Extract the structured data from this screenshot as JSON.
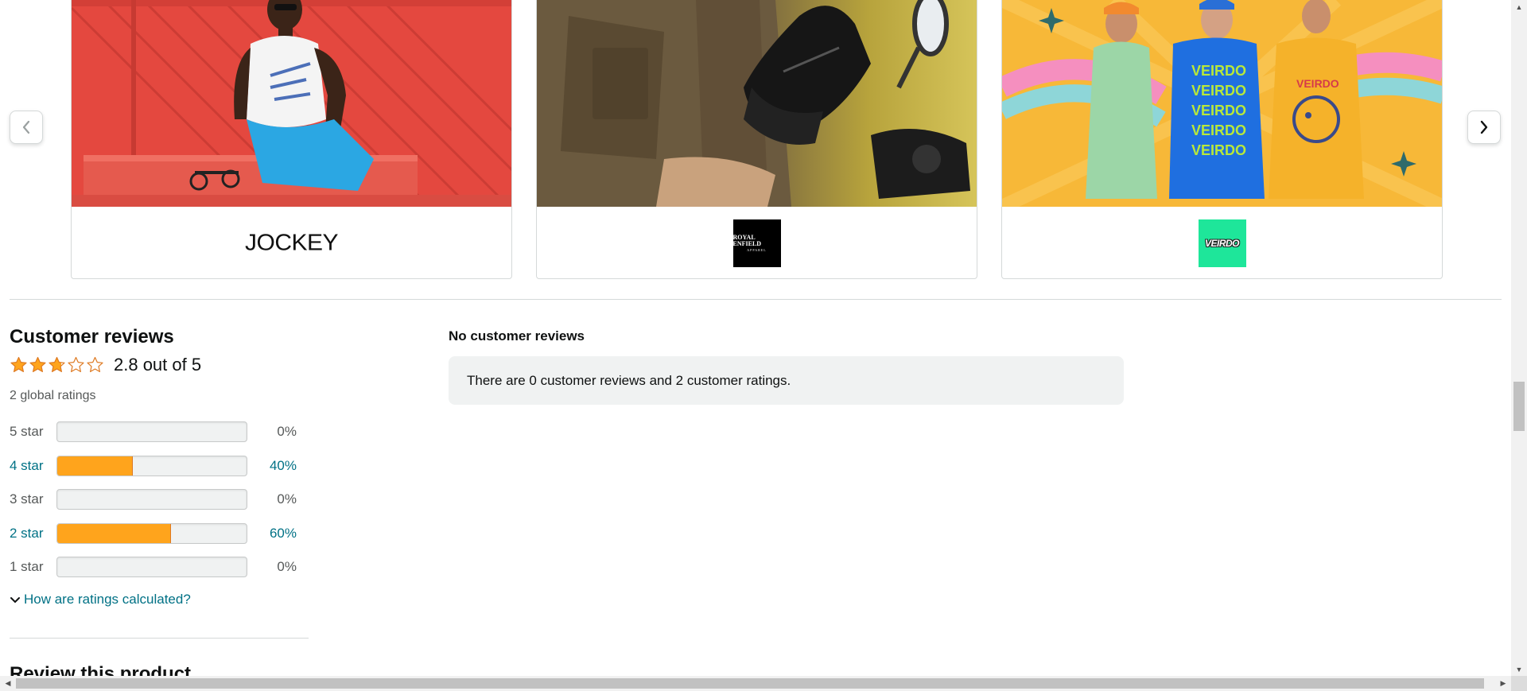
{
  "carousel": {
    "prev_icon": "chevron-left-icon",
    "next_icon": "chevron-right-icon",
    "cards": [
      {
        "brand": "JOCKEY",
        "hero_desc_icon": "model-photo-red-wall"
      },
      {
        "brand_line1": "ROYAL ENFIELD",
        "brand_line2": "APPAREL",
        "hero_desc_icon": "rider-gloves-photo"
      },
      {
        "brand": "VEIRDO",
        "hero_desc_icon": "three-models-tshirts-photo"
      }
    ]
  },
  "reviews": {
    "title": "Customer reviews",
    "rating": 2.8,
    "rating_text": "2.8 out of 5",
    "global_ratings": "2 global ratings",
    "histogram": [
      {
        "label": "5 star",
        "percent_text": "0%",
        "percent": 0,
        "linked": false
      },
      {
        "label": "4 star",
        "percent_text": "40%",
        "percent": 40,
        "linked": true
      },
      {
        "label": "3 star",
        "percent_text": "0%",
        "percent": 0,
        "linked": false
      },
      {
        "label": "2 star",
        "percent_text": "60%",
        "percent": 60,
        "linked": true
      },
      {
        "label": "1 star",
        "percent_text": "0%",
        "percent": 0,
        "linked": false
      }
    ],
    "calc_link": "How are ratings calculated?",
    "review_product_heading": "Review this product"
  },
  "no_reviews": {
    "title": "No customer reviews",
    "message": "There are 0 customer reviews and 2 customer ratings."
  },
  "colors": {
    "star": "#ffa41c",
    "link": "#007185",
    "bar_fill": "#ffa41c",
    "bar_bg": "#f0f2f2"
  }
}
